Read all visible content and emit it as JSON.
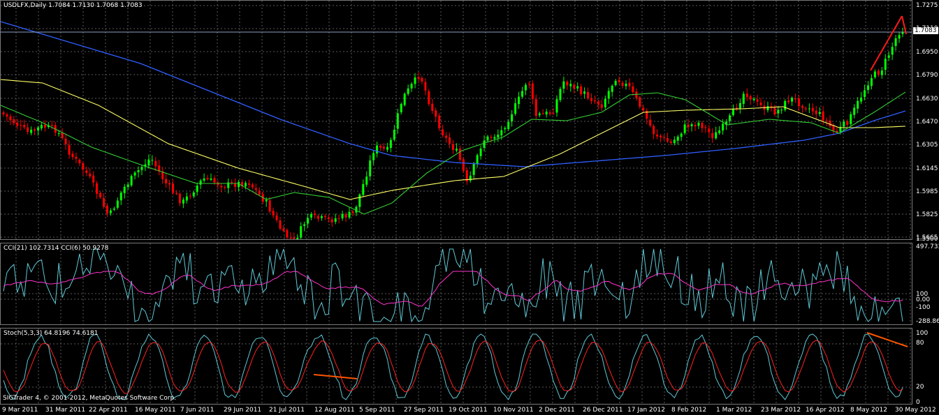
{
  "header": {
    "title": "USDLFX,Daily  1.7084 1.7130 1.7068 1.7083",
    "cci_title": "CCI(21) 102.7314  CCI(6) 50.9278",
    "stoch_title": "Stoch(5,3,3) 64.8196 74.6181",
    "copyright": "SIGTrader 4, © 2001-2012, MetaQuotes Software Corp."
  },
  "price_axis": [
    "1.7275",
    "1.7110",
    "1.6950",
    "1.6790",
    "1.6630",
    "1.6470",
    "1.6305",
    "1.6145",
    "1.5985",
    "1.5825",
    "1.5665",
    "1.5500"
  ],
  "current_price": "1.7083",
  "cci_axis": [
    "497.733",
    "100",
    "0.00",
    "-100",
    "-288.865"
  ],
  "stoch_axis": [
    "100",
    "80",
    "20",
    "0"
  ],
  "time_axis": [
    "9 Mar 2011",
    "31 Mar 2011",
    "22 Apr 2011",
    "16 May 2011",
    "7 Jun 2011",
    "29 Jun 2011",
    "21 Jul 2011",
    "12 Aug 2011",
    "5 Sep 2011",
    "27 Sep 2011",
    "19 Oct 2011",
    "10 Nov 2011",
    "2 Dec 2011",
    "26 Dec 2011",
    "17 Jan 2012",
    "8 Feb 2012",
    "1 Mar 2012",
    "23 Mar 2012",
    "16 Apr 2012",
    "8 May 2012",
    "30 May 2012"
  ],
  "colors": {
    "bull": "#00ff00",
    "bear": "#ff0000",
    "grid": "#5a5a5a",
    "ma_blue": "#2f5fff",
    "ma_yellow": "#ffff66",
    "ma_green": "#33cc33",
    "cci_main": "#5fc9d6",
    "cci_signal": "#ff33cc",
    "stoch_main": "#5fc9d6",
    "stoch_signal": "#ff2222",
    "trendline": "#ff5500"
  }
}
